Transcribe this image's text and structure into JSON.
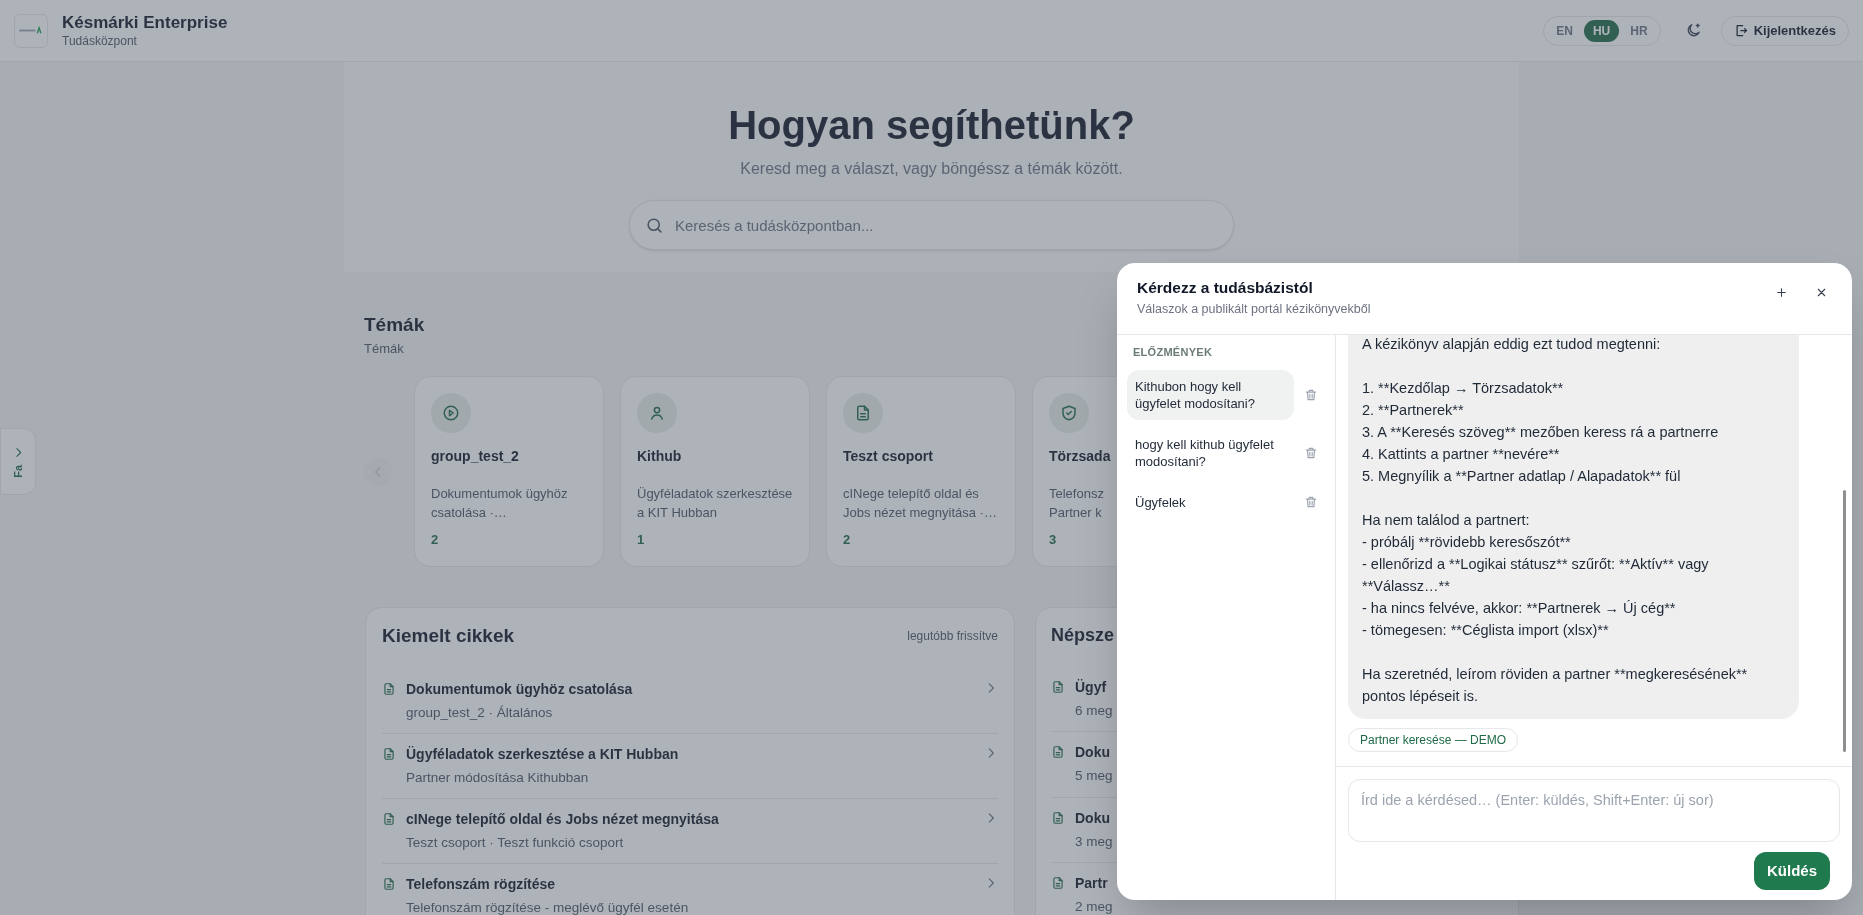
{
  "brand": {
    "title": "Késmárki Enterprise",
    "subtitle": "Tudásközpont"
  },
  "languages": [
    {
      "label": "EN",
      "selected": false
    },
    {
      "label": "HU",
      "selected": true
    },
    {
      "label": "HR",
      "selected": false
    }
  ],
  "logout_button": "Kijelentkezés",
  "hero": {
    "title": "Hogyan segíthetünk?",
    "subtitle": "Keresd meg a választ, vagy böngéssz a témák között.",
    "search_placeholder": "Keresés a tudásközpontban..."
  },
  "side_tab": {
    "label": "Fa"
  },
  "topics": {
    "title": "Témák",
    "subtitle": "Témák",
    "cards": [
      {
        "kind": "play",
        "title": "group_test_2",
        "description": [
          "Dokumentumok ügyhöz",
          "csatolása ·…"
        ],
        "count": "2"
      },
      {
        "kind": "user",
        "title": "Kithub",
        "description": [
          "Ügyféladatok szerkesztése",
          "a KIT Hubban"
        ],
        "count": "1"
      },
      {
        "kind": "document",
        "title": "Teszt csoport",
        "description": [
          "cINege telepítő oldal és",
          "Jobs nézet megnyitása ·…"
        ],
        "count": "2"
      },
      {
        "kind": "shield",
        "title": "Törzsada",
        "description": [
          "Telefonsz",
          "Partner k"
        ],
        "count": "3"
      }
    ]
  },
  "featured": {
    "title": "Kiemelt cikkek",
    "note": "legutóbb frissítve",
    "items": [
      {
        "title": "Dokumentumok ügyhöz csatolása",
        "meta": "group_test_2 · Általános"
      },
      {
        "title": "Ügyféladatok szerkesztése a KIT Hubban",
        "meta": "Partner módosítása Kithubban"
      },
      {
        "title": "cINege telepítő oldal és Jobs nézet megnyitása",
        "meta": "Teszt csoport · Teszt funkció csoport"
      },
      {
        "title": "Telefonszám rögzítése",
        "meta": "Telefonszám rögzítése - meglévő ügyfél esetén"
      }
    ]
  },
  "popular": {
    "title": "Népsze",
    "items": [
      {
        "title": "Ügyf",
        "meta": "6 meg"
      },
      {
        "title": "Doku",
        "meta": "5 meg"
      },
      {
        "title": "Doku",
        "meta": "3 meg"
      },
      {
        "title": "Partr",
        "meta": "2 meg"
      }
    ]
  },
  "chat": {
    "title": "Kérdezz a tudásbázistól",
    "subtitle": "Válaszok a publikált portál kézikönyvekből",
    "history_label": "ELŐZMÉNYEK",
    "history": [
      {
        "text": "Kithubon hogy kell ügyfelet modosítani?",
        "selected": true
      },
      {
        "text": "hogy kell kithub ügyfelet modosítani?",
        "selected": false
      },
      {
        "text": "Ügyfelek",
        "selected": false
      }
    ],
    "message": [
      [
        "A kézikönyv alapján eddig ezt tudod megtenni:"
      ],
      [
        "1. **Kezdőlap → Törzsadatok**",
        "2. **Partnerek**",
        "3. A **Keresés szöveg** mezőben keress rá a partnerre",
        "4. Kattints a partner **nevére**",
        "5. Megnyílik a **Partner adatlap / Alapadatok** fül"
      ],
      [
        "Ha nem találod a partnert:",
        "- próbálj **rövidebb keresőszót**",
        "- ellenőrizd a **Logikai státusz** szűrőt: **Aktív** vagy **Válassz…**",
        "- ha nincs felvéve, akkor: **Partnerek → Új cég**",
        "- tömegesen: **Céglista import (xlsx)**"
      ],
      [
        "Ha szeretnéd, leírom röviden a partner **megkeresésének** pontos lépéseit is."
      ]
    ],
    "source_chip": "Partner keresése — DEMO",
    "input_placeholder": "Írd ide a kérdésed… (Enter: küldés, Shift+Enter: új sor)",
    "send_button": "Küldés"
  }
}
